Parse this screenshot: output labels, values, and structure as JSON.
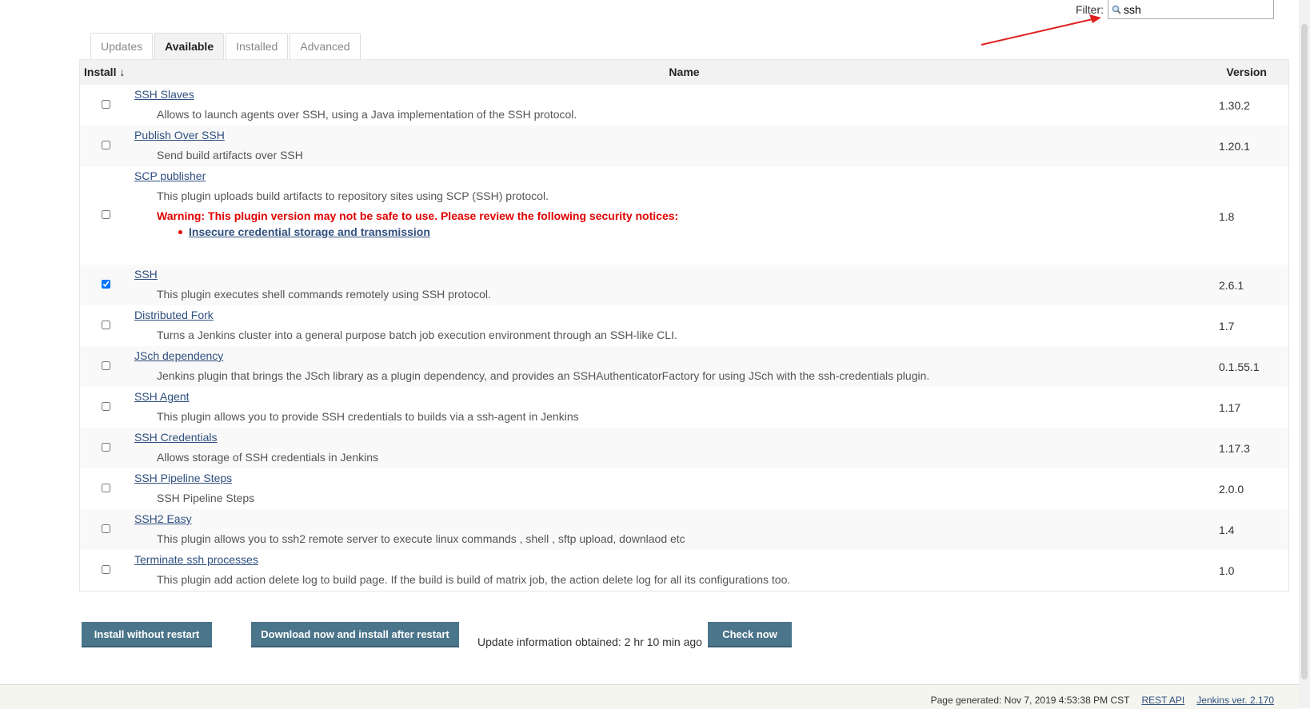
{
  "filter": {
    "label": "Filter:",
    "value": "ssh",
    "icon": "search-icon"
  },
  "tabs": [
    {
      "label": "Updates",
      "active": false
    },
    {
      "label": "Available",
      "active": true
    },
    {
      "label": "Installed",
      "active": false
    },
    {
      "label": "Advanced",
      "active": false
    }
  ],
  "table": {
    "headers": {
      "install": "Install ↓",
      "name": "Name",
      "version": "Version"
    },
    "rows": [
      {
        "name": "SSH Slaves",
        "description": "Allows to launch agents over SSH, using a Java implementation of the SSH protocol.",
        "version": "1.30.2",
        "checked": false
      },
      {
        "name": "Publish Over SSH",
        "description": "Send build artifacts over SSH",
        "version": "1.20.1",
        "checked": false
      },
      {
        "name": "SCP publisher",
        "description": "This plugin uploads build artifacts to repository sites using SCP (SSH) protocol.",
        "version": "1.8",
        "checked": false,
        "warning": "Warning: This plugin version may not be safe to use. Please review the following security notices:",
        "notice": "Insecure credential storage and transmission"
      },
      {
        "name": "SSH",
        "description": "This plugin executes shell commands remotely using SSH protocol.",
        "version": "2.6.1",
        "checked": true
      },
      {
        "name": "Distributed Fork",
        "description": "Turns a Jenkins cluster into a general purpose batch job execution environment through an SSH-like CLI.",
        "version": "1.7",
        "checked": false
      },
      {
        "name": "JSch dependency",
        "description": "Jenkins plugin that brings the JSch library as a plugin dependency, and provides an SSHAuthenticatorFactory for using JSch with the ssh-credentials plugin.",
        "version": "0.1.55.1",
        "checked": false
      },
      {
        "name": "SSH Agent",
        "description": "This plugin allows you to provide SSH credentials to builds via a ssh-agent in Jenkins",
        "version": "1.17",
        "checked": false
      },
      {
        "name": "SSH Credentials",
        "description": "Allows storage of SSH credentials in Jenkins",
        "version": "1.17.3",
        "checked": false
      },
      {
        "name": "SSH Pipeline Steps",
        "description": "SSH Pipeline Steps",
        "version": "2.0.0",
        "checked": false
      },
      {
        "name": "SSH2 Easy",
        "description": "This plugin allows you to ssh2 remote server to execute linux commands , shell , sftp upload, downlaod etc",
        "version": "1.4",
        "checked": false
      },
      {
        "name": "Terminate ssh processes",
        "description": "This plugin add action delete log to build page. If the build is build of matrix job, the action delete log for all its configurations too.",
        "version": "1.0",
        "checked": false
      }
    ]
  },
  "actions": {
    "install_without_restart": "Install without restart",
    "download_install_after_restart": "Download now and install after restart",
    "update_info": "Update information obtained: 2 hr 10 min ago",
    "check_now": "Check now"
  },
  "footer": {
    "page_generated": "Page generated: Nov 7, 2019 4:53:38 PM CST",
    "rest_api": "REST API",
    "jenkins_version": "Jenkins ver. 2.170"
  },
  "colors": {
    "link": "#2f4f7f",
    "warning": "#e00000",
    "button": "#4b758b",
    "annotation_arrow": "#e02020"
  }
}
